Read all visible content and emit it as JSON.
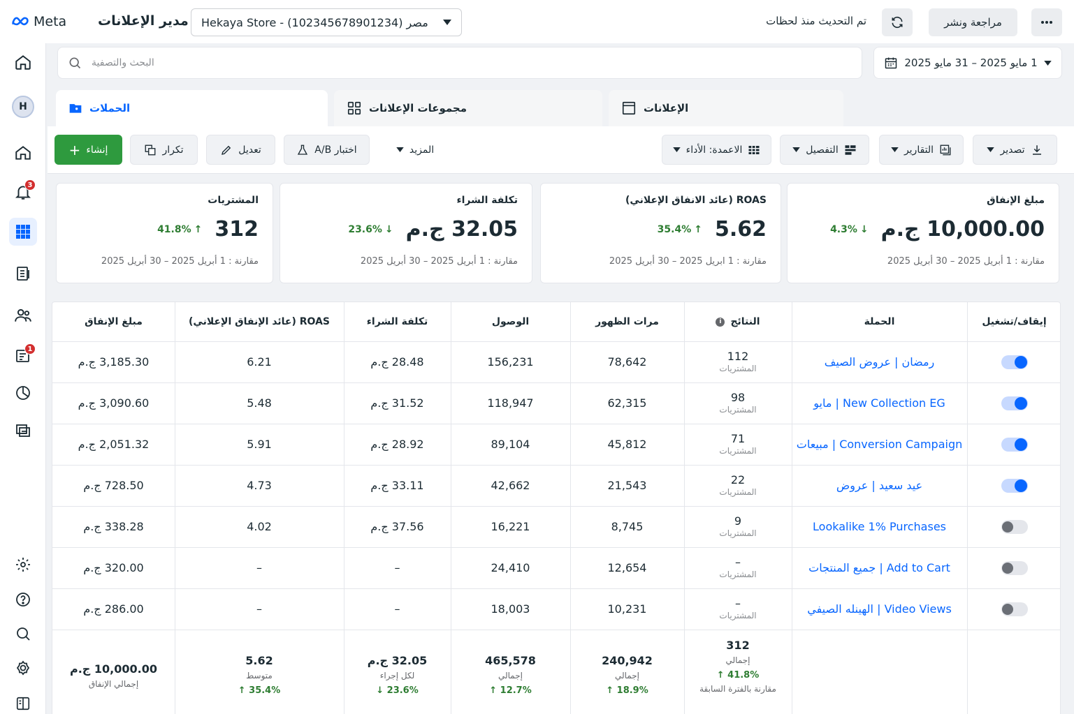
{
  "header": {
    "logo_text": "Meta",
    "app_title": "مدير الإعلانات",
    "account_selector": "Hekaya Store - مصر (102345678901234)",
    "updated_text": "تم التحديث منذ لحظات",
    "review_publish_label": "مراجعة ونشر"
  },
  "rail": {
    "avatar_initial": "H",
    "notifications_badge": "3",
    "pages_badge": "1"
  },
  "search": {
    "placeholder": "البحث والتصفية"
  },
  "date_range": {
    "label": "1 مايو 2025 – 31 مايو 2025"
  },
  "tabs": {
    "campaigns": "الحملات",
    "adsets": "مجموعات الإعلانات",
    "ads": "الإعلانات"
  },
  "toolbar": {
    "create": "إنشاء",
    "duplicate": "تكرار",
    "edit": "تعديل",
    "ab_test": "A/B اختبار",
    "more": "المزيد",
    "columns": "الاعمدة: الأداء",
    "breakdown": "التفصيل",
    "reports": "التقارير",
    "export": "تصدير"
  },
  "kpis": [
    {
      "title": "مبلغ الإنفاق",
      "value": "10,000.00 ج.م",
      "delta": "4.3%",
      "direction": "down",
      "compare": "مقارنة : 1 أبريل 2025 – 30 أبريل 2025"
    },
    {
      "title": "ROAS (عائد الانفاق الإعلاني)",
      "value": "5.62",
      "delta": "35.4%",
      "direction": "up",
      "compare": "مقارنة : 1 ابريل 2025 – 30 أبريل 2025"
    },
    {
      "title": "تكلفة الشراء",
      "value": "32.05 ج.م",
      "delta": "23.6%",
      "direction": "down",
      "compare": "مقارنة : 1 أبريل 2025 – 30 أبريل 2025"
    },
    {
      "title": "المشتريات",
      "value": "312",
      "delta": "41.8%",
      "direction": "up",
      "compare": "مقارنة : 1 أبريل 2025 – 30 أبريل 2025"
    }
  ],
  "table": {
    "headers": {
      "toggle": "إيقاف/تشغيل",
      "campaign": "الحملة",
      "results": "النتائج",
      "impressions": "مرات الظهور",
      "reach": "الوصول",
      "cpa": "تكلفة الشراء",
      "roas": "ROAS (عائد الإنفاق الإعلاني)",
      "spend": "مبلغ الإنفاق"
    },
    "rows": [
      {
        "on": true,
        "campaign": "رمضان | عروض الصيف",
        "results": "112",
        "results_sub": "المشتريات",
        "impressions": "78,642",
        "reach": "156,231",
        "cpa": "28.48 ج.م",
        "roas": "6.21",
        "spend": "3,185.30 ج.م"
      },
      {
        "on": true,
        "campaign": "New Collection EG | مايو",
        "results": "98",
        "results_sub": "المشتريات",
        "impressions": "62,315",
        "reach": "118,947",
        "cpa": "31.52 ج.م",
        "roas": "5.48",
        "spend": "3,090.60 ج.م"
      },
      {
        "on": true,
        "campaign": "Conversion Campaign | مبيعات",
        "results": "71",
        "results_sub": "المشتريات",
        "impressions": "45,812",
        "reach": "89,104",
        "cpa": "28.92 ج.م",
        "roas": "5.91",
        "spend": "2,051.32 ج.م"
      },
      {
        "on": true,
        "campaign": "عيد سعيد | عروض",
        "results": "22",
        "results_sub": "المشتريات",
        "impressions": "21,543",
        "reach": "42,662",
        "cpa": "33.11 ج.م",
        "roas": "4.73",
        "spend": "728.50 ج.م"
      },
      {
        "on": false,
        "campaign": "Lookalike 1% Purchases",
        "results": "9",
        "results_sub": "المشتريات",
        "impressions": "8,745",
        "reach": "16,221",
        "cpa": "37.56 ج.م",
        "roas": "4.02",
        "spend": "338.28 ج.م"
      },
      {
        "on": false,
        "campaign": "Add to Cart | جميع المنتجات",
        "results": "–",
        "results_sub": "المشتريات",
        "impressions": "12,654",
        "reach": "24,410",
        "cpa": "–",
        "roas": "–",
        "spend": "320.00 ج.م"
      },
      {
        "on": false,
        "campaign": "Video Views | الهينله الصيفي",
        "results": "–",
        "results_sub": "المشتريات",
        "impressions": "10,231",
        "reach": "18,003",
        "cpa": "–",
        "roas": "–",
        "spend": "286.00 ج.م"
      }
    ],
    "totals": {
      "results": {
        "main": "312",
        "sub": "إجمالي",
        "delta": "41.8%",
        "note": "مقارنة بالفترة السابقة"
      },
      "impressions": {
        "main": "240,942",
        "sub": "إجمالي",
        "delta": "18.9%"
      },
      "reach": {
        "main": "465,578",
        "sub": "إجمالي",
        "delta": "12.7%"
      },
      "cpa": {
        "main": "32.05 ج.م",
        "sub": "لكل إجراء",
        "delta": "23.6%"
      },
      "roas": {
        "main": "5.62",
        "sub": "متوسط",
        "delta": "35.4%"
      },
      "spend": {
        "main": "10,000.00 ج.م",
        "sub": "إجمالي الإنفاق"
      }
    }
  },
  "colors": {
    "accent": "#0866ff",
    "create": "#2e9a3e",
    "positive": "#2e7d32",
    "badge": "#d32f2f"
  }
}
